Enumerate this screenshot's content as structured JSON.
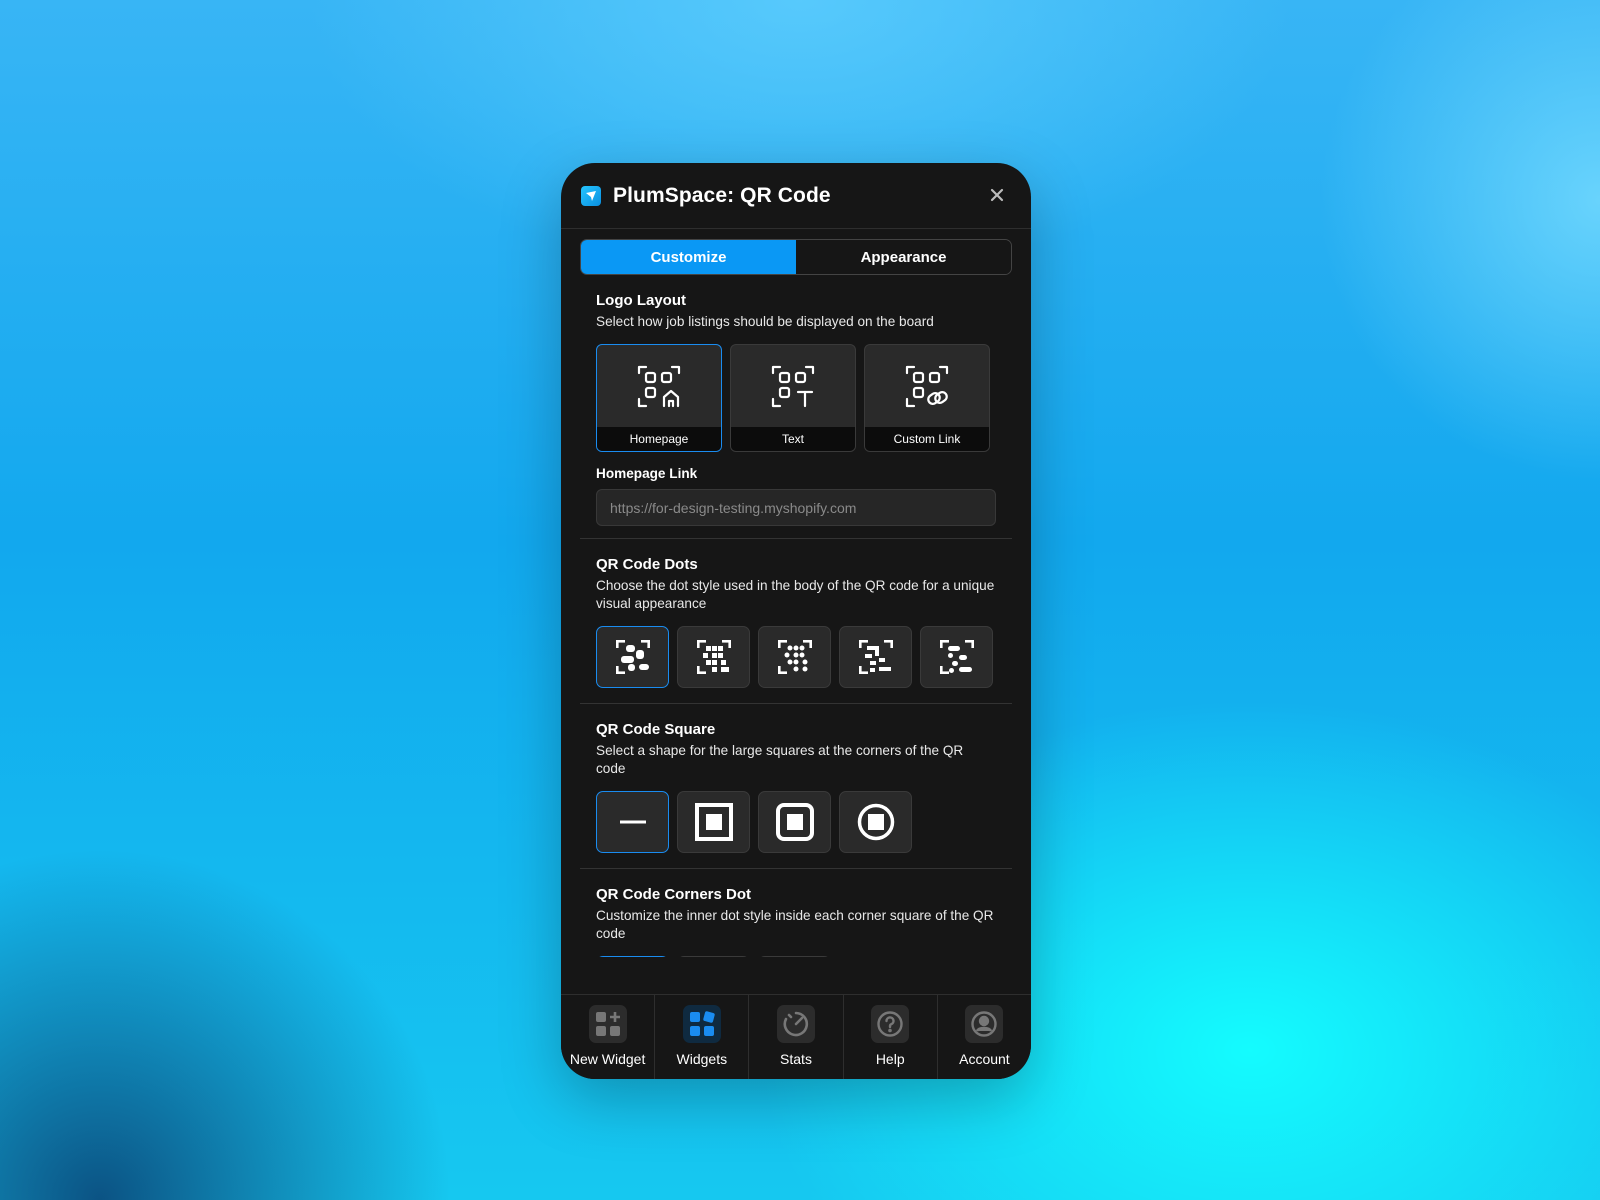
{
  "header": {
    "title": "PlumSpace: QR Code",
    "logo_icon": "app-logo-icon",
    "close_icon": "close-icon"
  },
  "tabs": [
    {
      "label": "Customize",
      "active": true
    },
    {
      "label": "Appearance",
      "active": false
    }
  ],
  "logo_layout": {
    "title": "Logo Layout",
    "description": "Select how job listings should be displayed on the board",
    "options": [
      {
        "label": "Homepage",
        "icon": "qr-home-icon",
        "selected": true
      },
      {
        "label": "Text",
        "icon": "qr-text-icon",
        "selected": false
      },
      {
        "label": "Custom Link",
        "icon": "qr-link-icon",
        "selected": false
      }
    ]
  },
  "homepage_link": {
    "label": "Homepage Link",
    "placeholder": "https://for-design-testing.myshopify.com"
  },
  "qr_dots": {
    "title": "QR Code Dots",
    "description": "Choose the dot style used in the body of the QR code for a unique visual appearance",
    "options": [
      "dots-rounded-icon",
      "dots-square-icon",
      "dots-circle-icon",
      "dots-classy-icon",
      "dots-extra-rounded-icon"
    ],
    "selected_index": 0
  },
  "qr_square": {
    "title": "QR Code Square",
    "description": "Select a shape for the large squares at the corners of the QR code",
    "options": [
      "none-icon",
      "square-icon",
      "rounded-square-icon",
      "circle-icon"
    ],
    "selected_index": 0
  },
  "qr_corners_dot": {
    "title": "QR Code Corners Dot",
    "description": "Customize the inner dot style inside each corner square of the QR code",
    "options": [
      "none-icon",
      "square-dot-icon",
      "circle-dot-icon"
    ],
    "selected_index": 0
  },
  "nav": [
    {
      "label": "New Widget",
      "icon": "new-widget-icon",
      "active": false
    },
    {
      "label": "Widgets",
      "icon": "widgets-icon",
      "active": true
    },
    {
      "label": "Stats",
      "icon": "stats-gauge-icon",
      "active": false
    },
    {
      "label": "Help",
      "icon": "help-icon",
      "active": false
    },
    {
      "label": "Account",
      "icon": "account-icon",
      "active": false
    }
  ],
  "colors": {
    "accent": "#0a98f5",
    "panel_bg": "#161616",
    "card_bg": "#2a2a2a"
  }
}
